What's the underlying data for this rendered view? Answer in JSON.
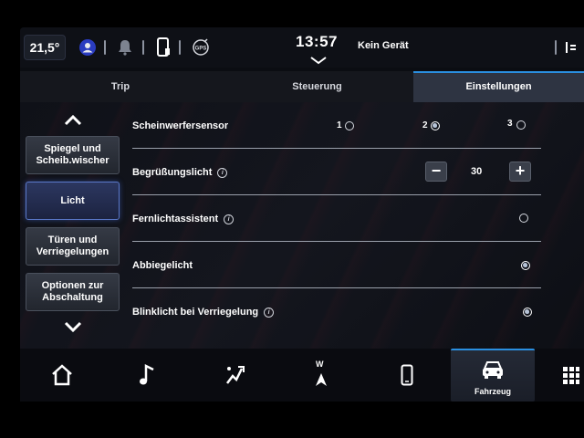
{
  "status": {
    "temperature": "21,5°",
    "clock": "13:57",
    "device_status": "Kein Gerät"
  },
  "tabs": [
    {
      "label": "Trip",
      "active": false
    },
    {
      "label": "Steuerung",
      "active": false
    },
    {
      "label": "Einstellungen",
      "active": true
    }
  ],
  "sidebar": {
    "items": [
      {
        "label_line1": "Spiegel und",
        "label_line2": "Scheib.wischer",
        "active": false
      },
      {
        "label_line1": "Licht",
        "label_line2": "",
        "active": true
      },
      {
        "label_line1": "Türen und",
        "label_line2": "Verriegelungen",
        "active": false
      },
      {
        "label_line1": "Optionen zur",
        "label_line2": "Abschaltung",
        "active": false
      }
    ]
  },
  "settings": {
    "scheinwerfer": {
      "label": "Scheinwerfersensor",
      "options": [
        "1",
        "2",
        "3"
      ],
      "selected": "2"
    },
    "begruessung": {
      "label": "Begrüßungslicht",
      "value": "30",
      "minus": "−",
      "plus": "+"
    },
    "fernlicht": {
      "label": "Fernlichtassistent",
      "enabled": false
    },
    "abbiege": {
      "label": "Abbiegelicht",
      "enabled": true
    },
    "blinklicht": {
      "label": "Blinklicht bei Verriegelung",
      "enabled": true
    }
  },
  "bottom_nav": {
    "items": [
      {
        "icon": "home-icon"
      },
      {
        "icon": "music-note-icon"
      },
      {
        "icon": "climate-fan-icon"
      },
      {
        "icon": "navigation-icon",
        "label": "W"
      },
      {
        "icon": "phone-icon"
      },
      {
        "icon": "car-icon",
        "label": "Fahrzeug",
        "active": true
      },
      {
        "icon": "apps-grid-icon"
      }
    ]
  },
  "colors": {
    "accent": "#2a8fe0",
    "active_side": "#2c3760"
  }
}
